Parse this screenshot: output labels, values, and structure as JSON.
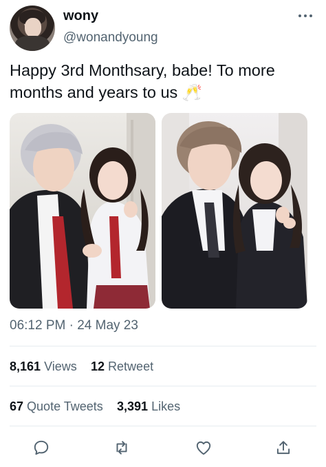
{
  "author": {
    "name": "wony",
    "handle": "@wonandyoung"
  },
  "tweet": {
    "text": "Happy 3rd Monthsary, babe!  To more months and years to us",
    "emoji": "🥂"
  },
  "meta": {
    "time": "06:12 PM",
    "separator": "·",
    "date": "24 May 23"
  },
  "stats": {
    "views_count": "8,161",
    "views_label": "Views",
    "retweets_count": "12",
    "retweets_label": "Retweet",
    "quotes_count": "67",
    "quotes_label": "Quote Tweets",
    "likes_count": "3,391",
    "likes_label": "Likes"
  },
  "icons": {
    "more": "more-horizontal-icon",
    "reply": "reply-icon",
    "retweet": "retweet-icon",
    "like": "heart-icon",
    "share": "share-icon"
  },
  "colors": {
    "text": "#0f1419",
    "secondary": "#536471",
    "divider": "#e6ecf0"
  }
}
